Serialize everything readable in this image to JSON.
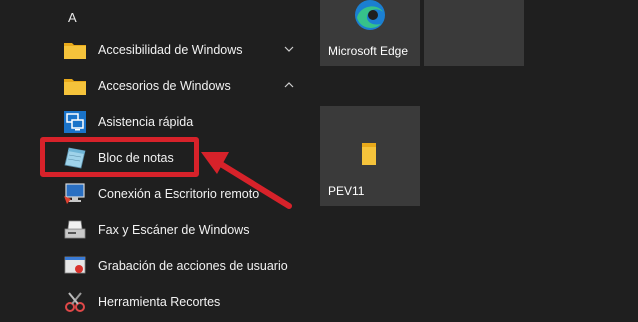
{
  "start_menu": {
    "section_letter": "A",
    "apps": [
      {
        "label": "Accesibilidad de Windows",
        "icon": "folder-icon",
        "type": "folder",
        "expanded": false
      },
      {
        "label": "Accesorios de Windows",
        "icon": "folder-icon",
        "type": "folder",
        "expanded": true
      },
      {
        "label": "Asistencia rápida",
        "icon": "quick-assist-icon",
        "type": "app"
      },
      {
        "label": "Bloc de notas",
        "icon": "notepad-icon",
        "type": "app",
        "highlighted": true
      },
      {
        "label": "Conexión a Escritorio remoto",
        "icon": "remote-desktop-icon",
        "type": "app"
      },
      {
        "label": "Fax y Escáner de Windows",
        "icon": "fax-scanner-icon",
        "type": "app"
      },
      {
        "label": "Grabación de acciones de usuario",
        "icon": "steps-recorder-icon",
        "type": "app"
      },
      {
        "label": "Herramienta Recortes",
        "icon": "snipping-tool-icon",
        "type": "app"
      }
    ]
  },
  "tiles": [
    {
      "label": "Microsoft Edge",
      "icon": "edge-icon"
    },
    {
      "label": "",
      "icon": ""
    },
    {
      "label": "PEV11",
      "icon": "folder-icon"
    }
  ],
  "annotation": {
    "highlight_color": "#d7222a"
  },
  "colors": {
    "background": "#1f1f1f",
    "tile": "#3a3a3a",
    "folder": "#f5c33b"
  }
}
